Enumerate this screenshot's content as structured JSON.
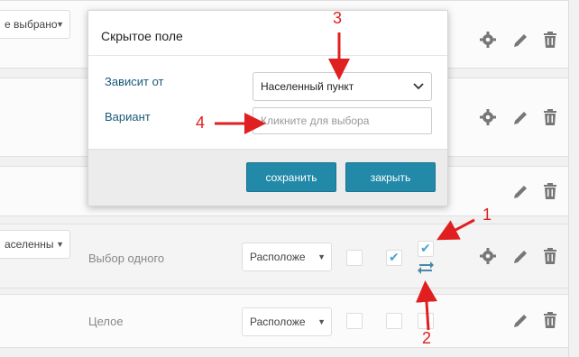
{
  "rows": [
    {
      "select_value": "е выбрано",
      "has_gear": true
    },
    {
      "has_gear": true
    },
    {
      "has_gear": false
    },
    {
      "select_value": "аселенны",
      "field_type": "Выбор одного",
      "position_select": "Расположе",
      "has_gear": true
    },
    {
      "field_type": "Целое",
      "position_select": "Расположе",
      "has_gear": false
    }
  ],
  "modal": {
    "title": "Скрытое поле",
    "depends_label": "Зависит от",
    "depends_value": "Населенный пункт",
    "variant_label": "Вариант",
    "variant_placeholder": "Кликните для выбора",
    "save_label": "сохранить",
    "close_label": "закрыть"
  },
  "annotations": [
    "1",
    "2",
    "3",
    "4"
  ],
  "colors": {
    "accent": "#2389a8",
    "annotation": "#e02020",
    "check": "#4aa3d6"
  }
}
